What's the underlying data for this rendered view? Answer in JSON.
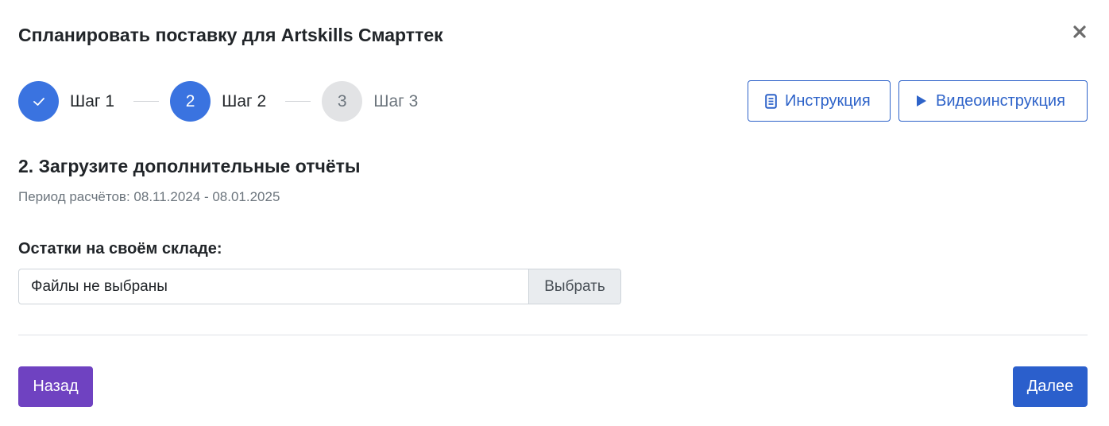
{
  "modal": {
    "title": "Спланировать поставку для Artskills Смарттек",
    "close_icon": "close-icon"
  },
  "stepper": {
    "steps": [
      {
        "number": "1",
        "label": "Шаг 1",
        "state": "done",
        "icon": "check-icon"
      },
      {
        "number": "2",
        "label": "Шаг 2",
        "state": "active"
      },
      {
        "number": "3",
        "label": "Шаг 3",
        "state": "pending"
      }
    ]
  },
  "actions": {
    "instruction_label": "Инструкция",
    "instruction_icon": "document-icon",
    "video_label": "Видеоинструкция",
    "video_icon": "play-icon"
  },
  "section": {
    "title": "2. Загрузите дополнительные отчёты",
    "period": "Период расчётов: 08.11.2024 - 08.01.2025"
  },
  "upload": {
    "label": "Остатки на своём складе:",
    "file_text": "Файлы не выбраны",
    "button_label": "Выбрать"
  },
  "footer": {
    "back_label": "Назад",
    "next_label": "Далее"
  },
  "colors": {
    "primary": "#3a73e0",
    "outline": "#2e63c9",
    "back_button": "#6f42c1",
    "next_button": "#2b5fcc",
    "pending_step": "#e2e3e5"
  }
}
